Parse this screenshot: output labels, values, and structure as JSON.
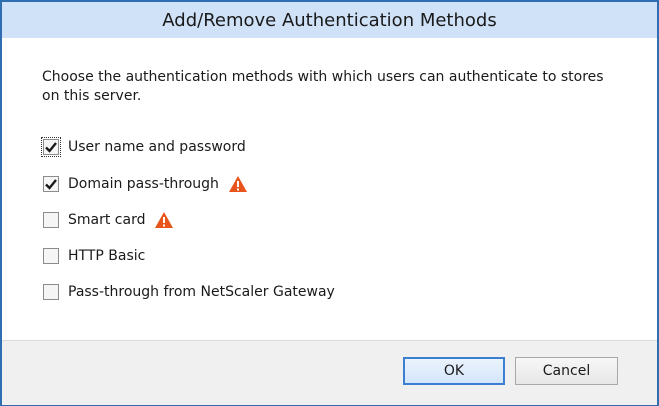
{
  "dialog": {
    "title": "Add/Remove Authentication Methods",
    "description": "Choose the authentication methods with which users can authenticate to stores on this server.",
    "options": [
      {
        "label": "User name and password",
        "checked": true,
        "warning": false
      },
      {
        "label": "Domain pass-through",
        "checked": true,
        "warning": true
      },
      {
        "label": "Smart card",
        "checked": false,
        "warning": true
      },
      {
        "label": "HTTP Basic",
        "checked": false,
        "warning": false
      },
      {
        "label": "Pass-through from NetScaler Gateway",
        "checked": false,
        "warning": false
      }
    ],
    "buttons": {
      "ok_label": "OK",
      "cancel_label": "Cancel"
    }
  },
  "colors": {
    "titlebar": "#cfe2f7",
    "border": "#2f6fb1",
    "warning": "#e8541c",
    "footer": "#f0f0f0"
  },
  "icons": {
    "warning": "warning-icon",
    "check": "checkmark-icon"
  }
}
